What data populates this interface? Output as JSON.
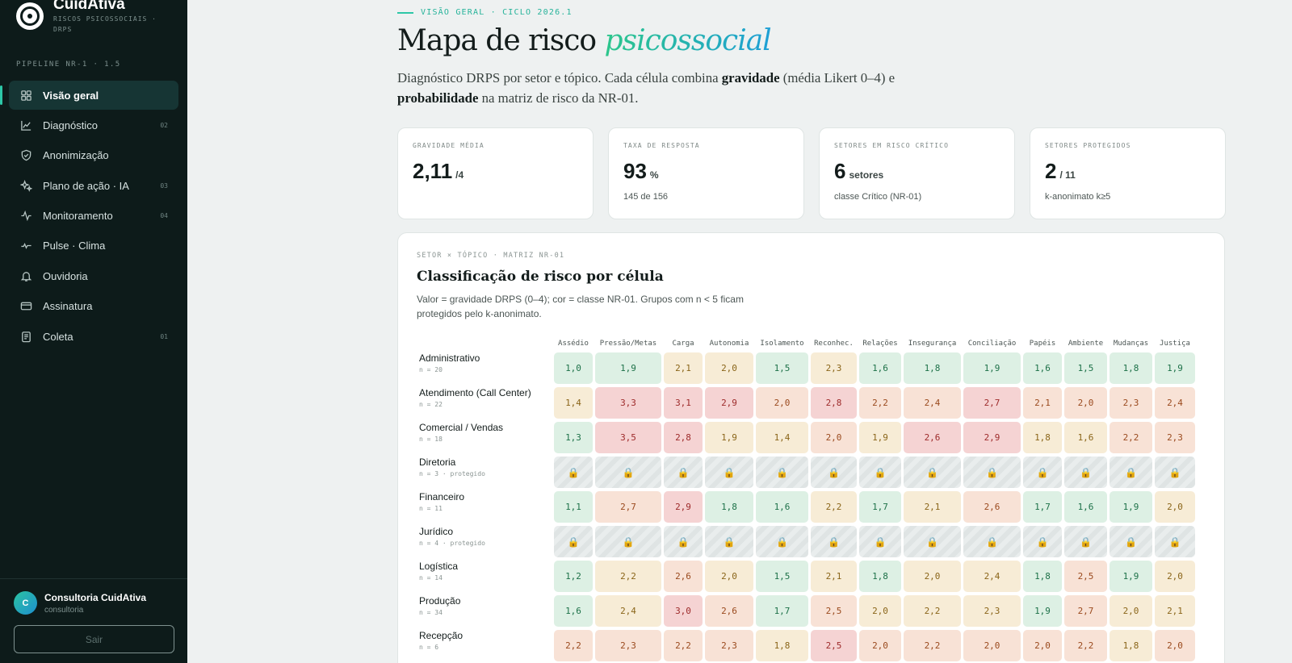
{
  "brand": {
    "name": "CuidAtiva",
    "subtitle": "RISCOS PSICOSSOCIAIS · DRPS"
  },
  "sidebar": {
    "pipeline": "PIPELINE NR-1 · 1.5",
    "items": [
      {
        "label": "Visão geral",
        "icon": "grid-icon",
        "badge": "",
        "active": true
      },
      {
        "label": "Diagnóstico",
        "icon": "chart-line-icon",
        "badge": "02",
        "active": false
      },
      {
        "label": "Anonimização",
        "icon": "shield-check-icon",
        "badge": "",
        "active": false
      },
      {
        "label": "Plano de ação · IA",
        "icon": "sparkles-icon",
        "badge": "03",
        "active": false
      },
      {
        "label": "Monitoramento",
        "icon": "activity-icon",
        "badge": "04",
        "active": false
      },
      {
        "label": "Pulse · Clima",
        "icon": "pulse-icon",
        "badge": "",
        "active": false
      },
      {
        "label": "Ouvidoria",
        "icon": "bell-icon",
        "badge": "",
        "active": false
      },
      {
        "label": "Assinatura",
        "icon": "credit-card-icon",
        "badge": "",
        "active": false
      },
      {
        "label": "Coleta",
        "icon": "clipboard-icon",
        "badge": "01",
        "active": false
      }
    ],
    "user": {
      "initial": "C",
      "name": "Consultoria CuidAtiva",
      "role": "consultoria"
    },
    "logout_label": "Sair"
  },
  "header": {
    "eyebrow": "VISÃO GERAL · CICLO 2026.1",
    "title_plain": "Mapa de risco ",
    "title_accent": "psicossocial",
    "lede": {
      "t1": "Diagnóstico DRPS por setor e tópico. Cada célula combina ",
      "b1": "gravidade",
      "t2": " (média Likert 0–4) e ",
      "b2": "probabilidade",
      "t3": " na matriz de risco da NR-01."
    }
  },
  "kpis": [
    {
      "label": "GRAVIDADE MÉDIA",
      "value": "2,11",
      "unit": "/4",
      "note": ""
    },
    {
      "label": "TAXA DE RESPOSTA",
      "value": "93",
      "unit": "%",
      "note": "145 de 156"
    },
    {
      "label": "SETORES EM RISCO CRÍTICO",
      "value": "6",
      "unit": "setores",
      "note": "classe Crítico (NR-01)"
    },
    {
      "label": "SETORES PROTEGIDOS",
      "value": "2",
      "unit": "/ 11",
      "note": "k-anonimato k≥5"
    }
  ],
  "matrix": {
    "eyebrow": "SETOR × TÓPICO · MATRIZ NR-01",
    "title": "Classificação de risco por célula",
    "description": "Valor = gravidade DRPS (0–4); cor = classe NR-01. Grupos com n < 5 ficam protegidos pelo k-anonimato.",
    "lock_glyph": "🔒",
    "colors": {
      "baixo": "#ddf0e4",
      "moderado": "#f7ecd6",
      "alto": "#f8e2d6",
      "critico": "#f5d3d3"
    },
    "columns": [
      "Assédio",
      "Pressão/Metas",
      "Carga",
      "Autonomia",
      "Isolamento",
      "Reconhec.",
      "Relações",
      "Insegurança",
      "Conciliação",
      "Papéis",
      "Ambiente",
      "Mudanças",
      "Justiça"
    ],
    "rows": [
      {
        "name": "Administrativo",
        "n": "n = 20",
        "protected": false,
        "values": [
          "1,0",
          "1,9",
          "2,1",
          "2,0",
          "1,5",
          "2,3",
          "1,6",
          "1,8",
          "1,9",
          "1,6",
          "1,5",
          "1,8",
          "1,9"
        ],
        "classes": [
          "g",
          "g",
          "y",
          "y",
          "g",
          "y",
          "g",
          "g",
          "g",
          "g",
          "g",
          "g",
          "g"
        ]
      },
      {
        "name": "Atendimento (Call Center)",
        "n": "n = 22",
        "protected": false,
        "values": [
          "1,4",
          "3,3",
          "3,1",
          "2,9",
          "2,0",
          "2,8",
          "2,2",
          "2,4",
          "2,7",
          "2,1",
          "2,0",
          "2,3",
          "2,4"
        ],
        "classes": [
          "y",
          "r",
          "r",
          "r",
          "o",
          "r",
          "o",
          "o",
          "r",
          "o",
          "o",
          "o",
          "o"
        ]
      },
      {
        "name": "Comercial / Vendas",
        "n": "n = 18",
        "protected": false,
        "values": [
          "1,3",
          "3,5",
          "2,8",
          "1,9",
          "1,4",
          "2,0",
          "1,9",
          "2,6",
          "2,9",
          "1,8",
          "1,6",
          "2,2",
          "2,3"
        ],
        "classes": [
          "g",
          "r",
          "r",
          "y",
          "y",
          "o",
          "y",
          "r",
          "r",
          "y",
          "y",
          "o",
          "o"
        ]
      },
      {
        "name": "Diretoria",
        "n": "n = 3 · protegido",
        "protected": true,
        "values": [],
        "classes": []
      },
      {
        "name": "Financeiro",
        "n": "n = 11",
        "protected": false,
        "values": [
          "1,1",
          "2,7",
          "2,9",
          "1,8",
          "1,6",
          "2,2",
          "1,7",
          "2,1",
          "2,6",
          "1,7",
          "1,6",
          "1,9",
          "2,0"
        ],
        "classes": [
          "g",
          "o",
          "r",
          "g",
          "g",
          "y",
          "g",
          "y",
          "o",
          "g",
          "g",
          "g",
          "y"
        ]
      },
      {
        "name": "Jurídico",
        "n": "n = 4 · protegido",
        "protected": true,
        "values": [],
        "classes": []
      },
      {
        "name": "Logística",
        "n": "n = 14",
        "protected": false,
        "values": [
          "1,2",
          "2,2",
          "2,6",
          "2,0",
          "1,5",
          "2,1",
          "1,8",
          "2,0",
          "2,4",
          "1,8",
          "2,5",
          "1,9",
          "2,0"
        ],
        "classes": [
          "g",
          "y",
          "o",
          "y",
          "g",
          "y",
          "g",
          "y",
          "y",
          "g",
          "o",
          "g",
          "y"
        ]
      },
      {
        "name": "Produção",
        "n": "n = 34",
        "protected": false,
        "values": [
          "1,6",
          "2,4",
          "3,0",
          "2,6",
          "1,7",
          "2,5",
          "2,0",
          "2,2",
          "2,3",
          "1,9",
          "2,7",
          "2,0",
          "2,1"
        ],
        "classes": [
          "g",
          "y",
          "r",
          "o",
          "g",
          "o",
          "y",
          "y",
          "y",
          "g",
          "o",
          "y",
          "y"
        ]
      },
      {
        "name": "Recepção",
        "n": "n = 6",
        "protected": false,
        "values": [
          "2,2",
          "2,3",
          "2,2",
          "2,3",
          "1,8",
          "2,5",
          "2,0",
          "2,2",
          "2,0",
          "2,0",
          "2,2",
          "1,8",
          "2,0"
        ],
        "classes": [
          "o",
          "o",
          "o",
          "o",
          "y",
          "r",
          "o",
          "o",
          "o",
          "o",
          "o",
          "y",
          "o"
        ]
      }
    ]
  }
}
